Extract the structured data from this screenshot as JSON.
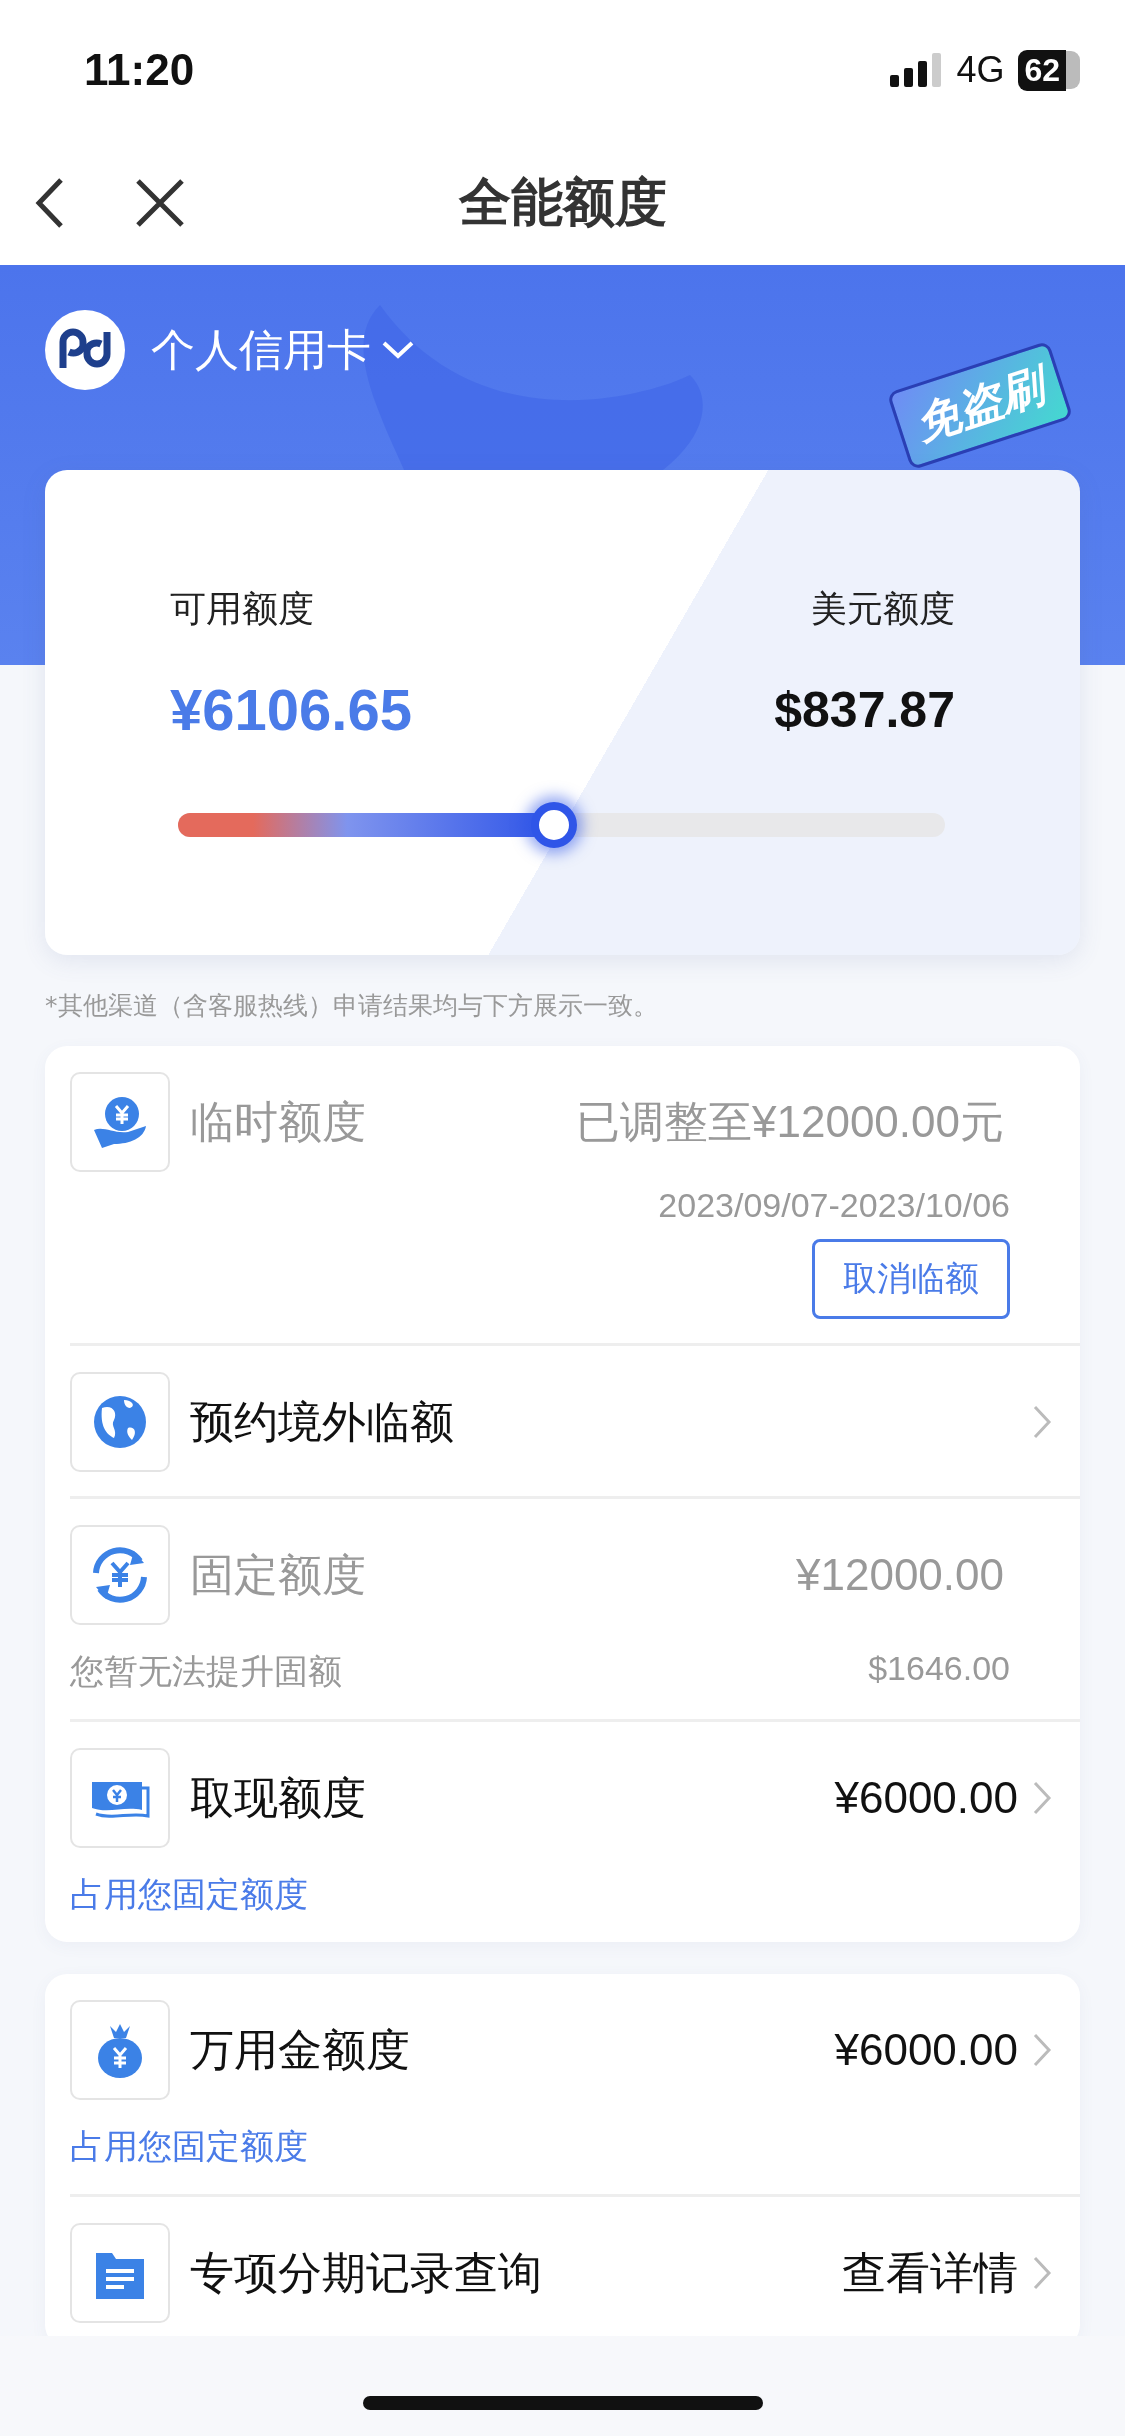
{
  "status_bar": {
    "time": "11:20",
    "network": "4G",
    "battery": "62"
  },
  "nav": {
    "title": "全能额度"
  },
  "account": {
    "name": "个人信用卡",
    "badge": "免盗刷"
  },
  "limit": {
    "available_label": "可用额度",
    "available": "¥6106.65",
    "usd_label": "美元额度",
    "usd": "$837.87",
    "level": 0.49
  },
  "note": "*其他渠道（含客服热线）申请结果均与下方展示一致。",
  "cards": [
    {
      "rows": [
        {
          "kind": "hand-yen",
          "title": "临时额度",
          "value": "已调整至¥12000.00元",
          "date": "2023/09/07-2023/10/06",
          "button": "取消临额",
          "disabled": true,
          "chevron": false
        },
        {
          "kind": "globe",
          "title": "预约境外临额",
          "disabled": false,
          "chevron": true
        },
        {
          "kind": "yen-cycle",
          "title": "固定额度",
          "value": "¥12000.00",
          "sub": "您暂无法提升固额",
          "sub_value": "$1646.00",
          "disabled": true,
          "chevron": false
        },
        {
          "kind": "banknote",
          "title": "取现额度",
          "value": "¥6000.00",
          "sub": "占用您固定额度",
          "disabled": false,
          "chevron": true
        }
      ]
    },
    {
      "rows": [
        {
          "kind": "money-bag",
          "title": "万用金额度",
          "value": "¥6000.00",
          "sub": "占用您固定额度",
          "disabled": false,
          "chevron": true
        },
        {
          "kind": "folder",
          "title": "专项分期记录查询",
          "value": "查看详情",
          "disabled": false,
          "chevron": true
        }
      ]
    }
  ]
}
